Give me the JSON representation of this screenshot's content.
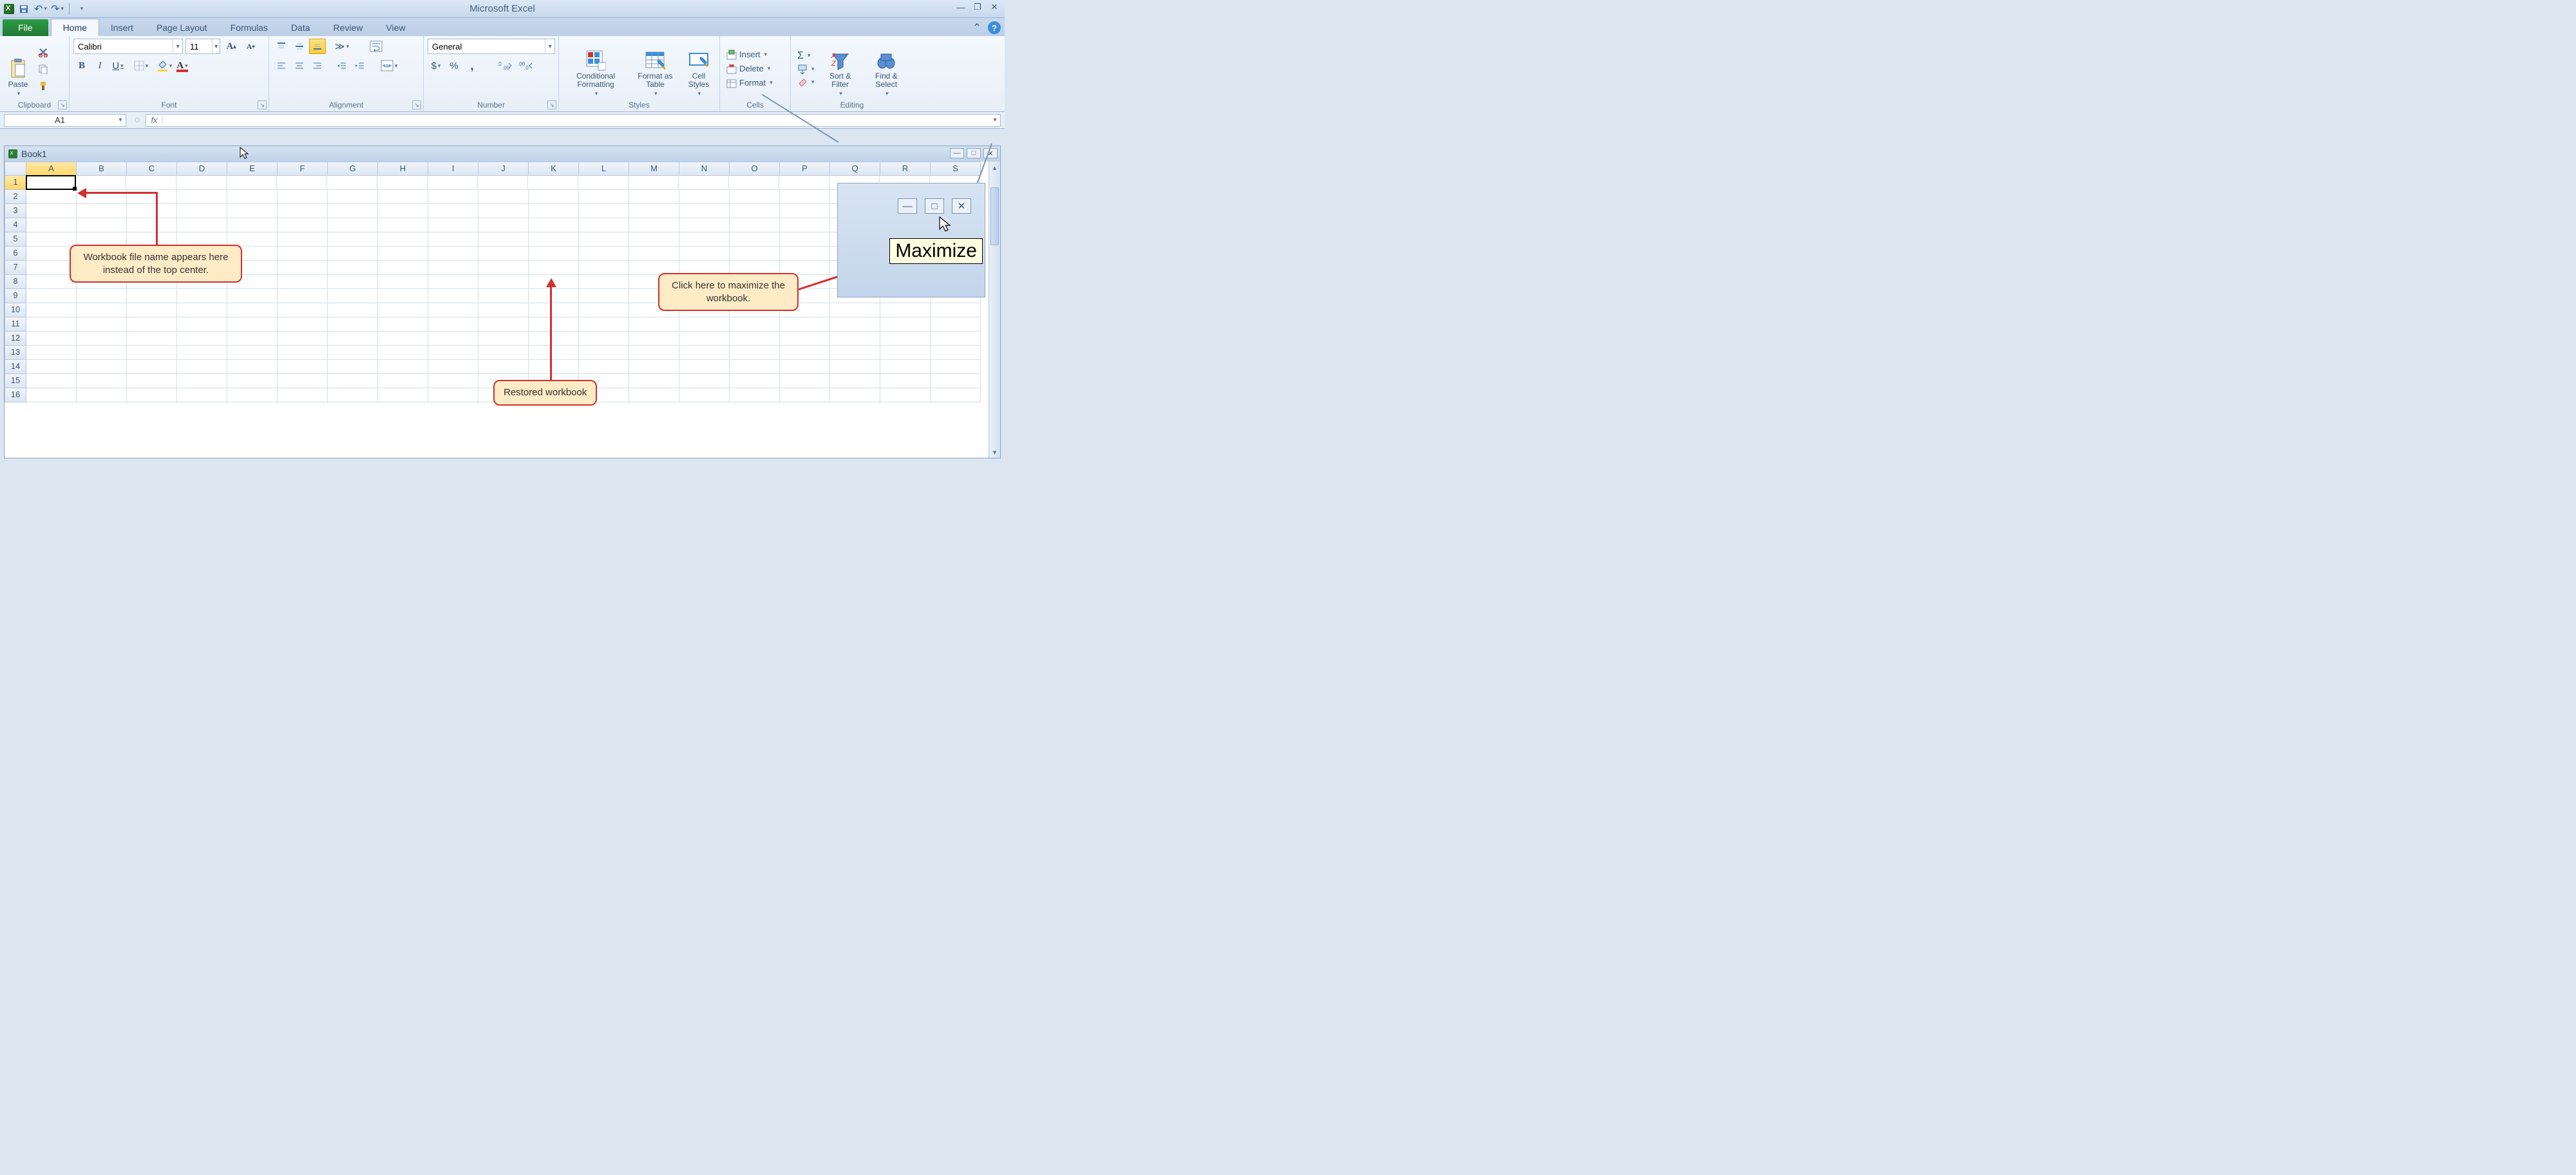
{
  "app": {
    "title": "Microsoft Excel"
  },
  "tabs": {
    "file": "File",
    "items": [
      "Home",
      "Insert",
      "Page Layout",
      "Formulas",
      "Data",
      "Review",
      "View"
    ],
    "active": "Home"
  },
  "ribbon": {
    "clipboard": {
      "label": "Clipboard",
      "paste": "Paste"
    },
    "font": {
      "label": "Font",
      "name": "Calibri",
      "size": "11",
      "bold": "B",
      "italic": "I",
      "underline": "U"
    },
    "alignment": {
      "label": "Alignment"
    },
    "number": {
      "label": "Number",
      "format": "General",
      "currency": "$",
      "percent": "%",
      "comma": ",",
      "inc": ".0",
      "dec": ".00"
    },
    "styles": {
      "label": "Styles",
      "conditional": "Conditional Formatting",
      "table": "Format as Table",
      "cell": "Cell Styles"
    },
    "cells": {
      "label": "Cells",
      "insert": "Insert",
      "delete": "Delete",
      "format": "Format"
    },
    "editing": {
      "label": "Editing",
      "sort": "Sort & Filter",
      "find": "Find & Select"
    }
  },
  "formula_bar": {
    "name_box": "A1",
    "fx": "fx"
  },
  "workbook": {
    "title": "Book1",
    "columns": [
      "A",
      "B",
      "C",
      "D",
      "E",
      "F",
      "G",
      "H",
      "I",
      "J",
      "K",
      "L",
      "M",
      "N",
      "O",
      "P",
      "Q",
      "R",
      "S"
    ],
    "active_col": "A",
    "row_count": 16,
    "active_row": 1
  },
  "callouts": {
    "filename": "Workbook file name appears here instead of the top center.",
    "restored": "Restored workbook",
    "maximize": "Click here to maximize the workbook."
  },
  "popout": {
    "tooltip": "Maximize"
  }
}
